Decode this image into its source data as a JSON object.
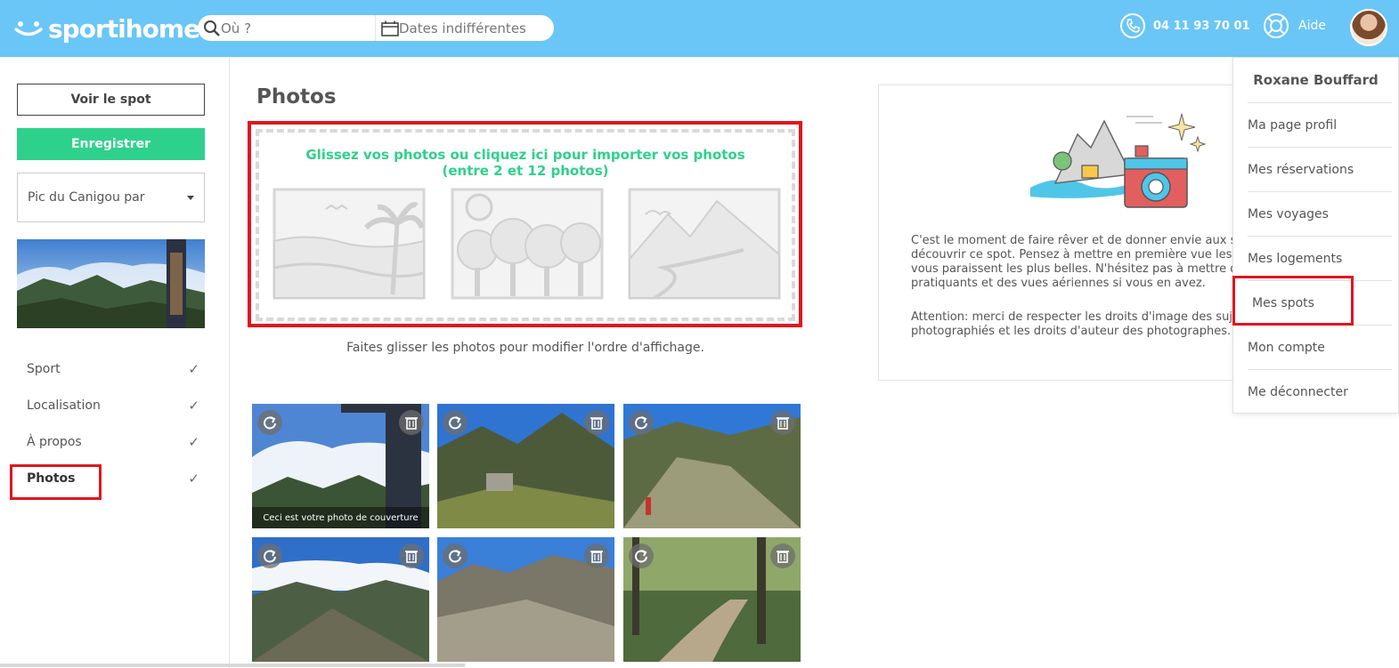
{
  "header": {
    "logo": "sportihome",
    "search_where_placeholder": "Où ?",
    "search_dates_placeholder": "Dates indifférentes",
    "phone": "04 11 93 70 01",
    "help": "Aide"
  },
  "sidebar": {
    "view_spot": "Voir le spot",
    "save": "Enregistrer",
    "spot_select": "Pic du Canigou par",
    "steps": [
      {
        "label": "Sport"
      },
      {
        "label": "Localisation"
      },
      {
        "label": "À propos"
      },
      {
        "label": "Photos"
      }
    ]
  },
  "main": {
    "title": "Photos",
    "upload_line1": "Glissez vos photos ou cliquez ici pour importer vos photos",
    "upload_line2": "(entre 2 et 12 photos)",
    "drag_hint": "Faites glisser les photos pour modifier l'ordre d'affichage.",
    "cover_caption": "Ceci est votre photo de couverture"
  },
  "info": {
    "lines1": [
      "C'est le moment de faire rêver et de donner envie aux s",
      "découvrir ce spot. Pensez à mettre en première vue les",
      "vous paraissent les plus belles. N'hésitez pas à mettre d",
      "pratiquants et des vues aériennes si vous en avez."
    ],
    "lines2": [
      "Attention: merci de respecter les droits d'image des suje",
      "photographiés et les droits d'auteur des photographes."
    ]
  },
  "dropdown": {
    "user_name": "Roxane Bouffard",
    "items": [
      {
        "label": "Ma page profil"
      },
      {
        "label": "Mes réservations"
      },
      {
        "label": "Mes voyages"
      },
      {
        "label": "Mes logements"
      },
      {
        "label": "Mes spots"
      },
      {
        "label": "Mon compte"
      },
      {
        "label": "Me déconnecter"
      }
    ]
  },
  "colors": {
    "header": "#6ac6f6",
    "accent_green": "#2ed18b",
    "highlight_red": "#e0161f"
  }
}
